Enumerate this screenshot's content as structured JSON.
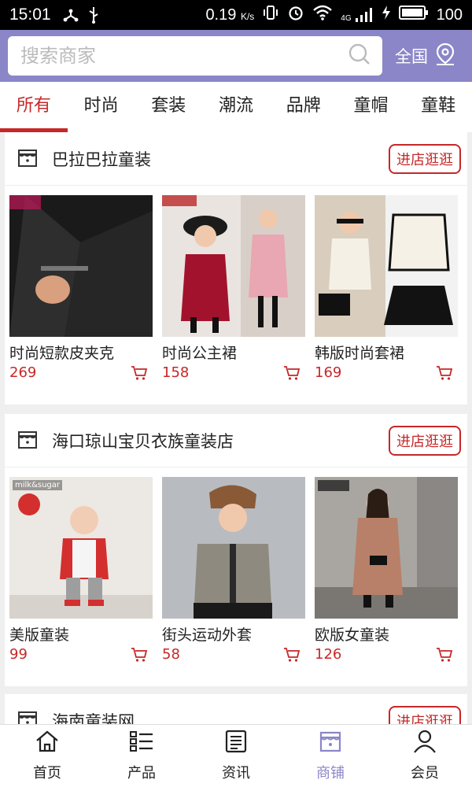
{
  "status": {
    "time": "15:01",
    "speed": "0.19",
    "speed_unit": "K/s",
    "network": "4G",
    "battery": "100"
  },
  "search": {
    "placeholder": "搜索商家",
    "region": "全国"
  },
  "tabs": [
    {
      "label": "所有",
      "active": true
    },
    {
      "label": "时尚"
    },
    {
      "label": "套装"
    },
    {
      "label": "潮流"
    },
    {
      "label": "品牌"
    },
    {
      "label": "童帽"
    },
    {
      "label": "童鞋"
    }
  ],
  "shops": [
    {
      "name": "巴拉巴拉童装",
      "button": "进店逛逛",
      "items": [
        {
          "name": "时尚短款皮夹克",
          "price": "269",
          "tag": ""
        },
        {
          "name": "时尚公主裙",
          "price": "158",
          "tag": ""
        },
        {
          "name": "韩版时尚套裙",
          "price": "169",
          "tag": ""
        }
      ]
    },
    {
      "name": "海口琼山宝贝衣族童装店",
      "button": "进店逛逛",
      "items": [
        {
          "name": "美版童装",
          "price": "99",
          "tag": "milk&sugar"
        },
        {
          "name": "街头运动外套",
          "price": "58",
          "tag": ""
        },
        {
          "name": "欧版女童装",
          "price": "126",
          "tag": ""
        }
      ]
    },
    {
      "name": "海南童装网",
      "button": "进店逛逛",
      "items": []
    }
  ],
  "nav": [
    {
      "label": "首页",
      "icon": "home-icon"
    },
    {
      "label": "产品",
      "icon": "list-icon"
    },
    {
      "label": "资讯",
      "icon": "news-icon"
    },
    {
      "label": "商铺",
      "icon": "store-icon",
      "active": true
    },
    {
      "label": "会员",
      "icon": "user-icon"
    }
  ],
  "colors": {
    "accent": "#c62828",
    "header": "#8b86c8"
  }
}
